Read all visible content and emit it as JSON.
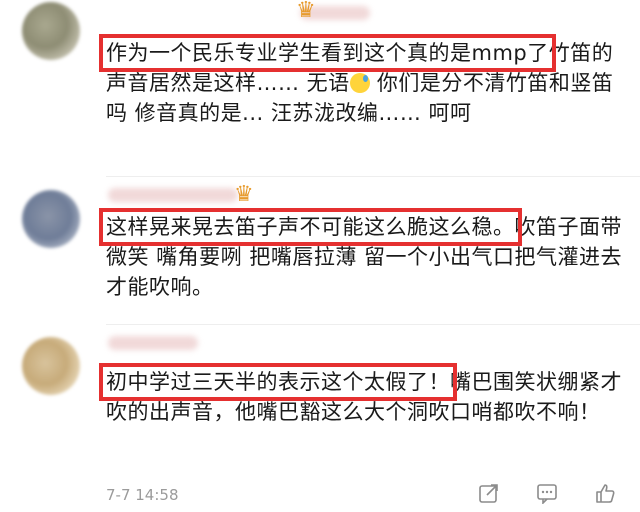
{
  "comments": [
    {
      "highlight": "作为一个民乐专业学生看到这个真的是mmp了",
      "rest": "竹笛的声音居然是这样…… 无语",
      "rest2": " 你们是分不清竹笛和竖笛吗  修音真的是... 汪苏泷改编…… 呵呵"
    },
    {
      "highlight": "这样晃来晃去笛子声不可能这么脆这么稳。",
      "rest": "吹笛子面带微笑 嘴角要咧 把嘴唇拉薄 留一个小出气口把气灌进去才能吹响。"
    },
    {
      "highlight": "初中学过三天半的表示这个太假了！",
      "rest": "嘴巴围笑状绷紧才吹的出声音，他嘴巴豁这么大个洞吹口哨都吹不响！",
      "date": "7-7 14:58"
    }
  ],
  "icons": {
    "share": "share-icon",
    "comment": "comment-icon",
    "like": "like-icon"
  }
}
